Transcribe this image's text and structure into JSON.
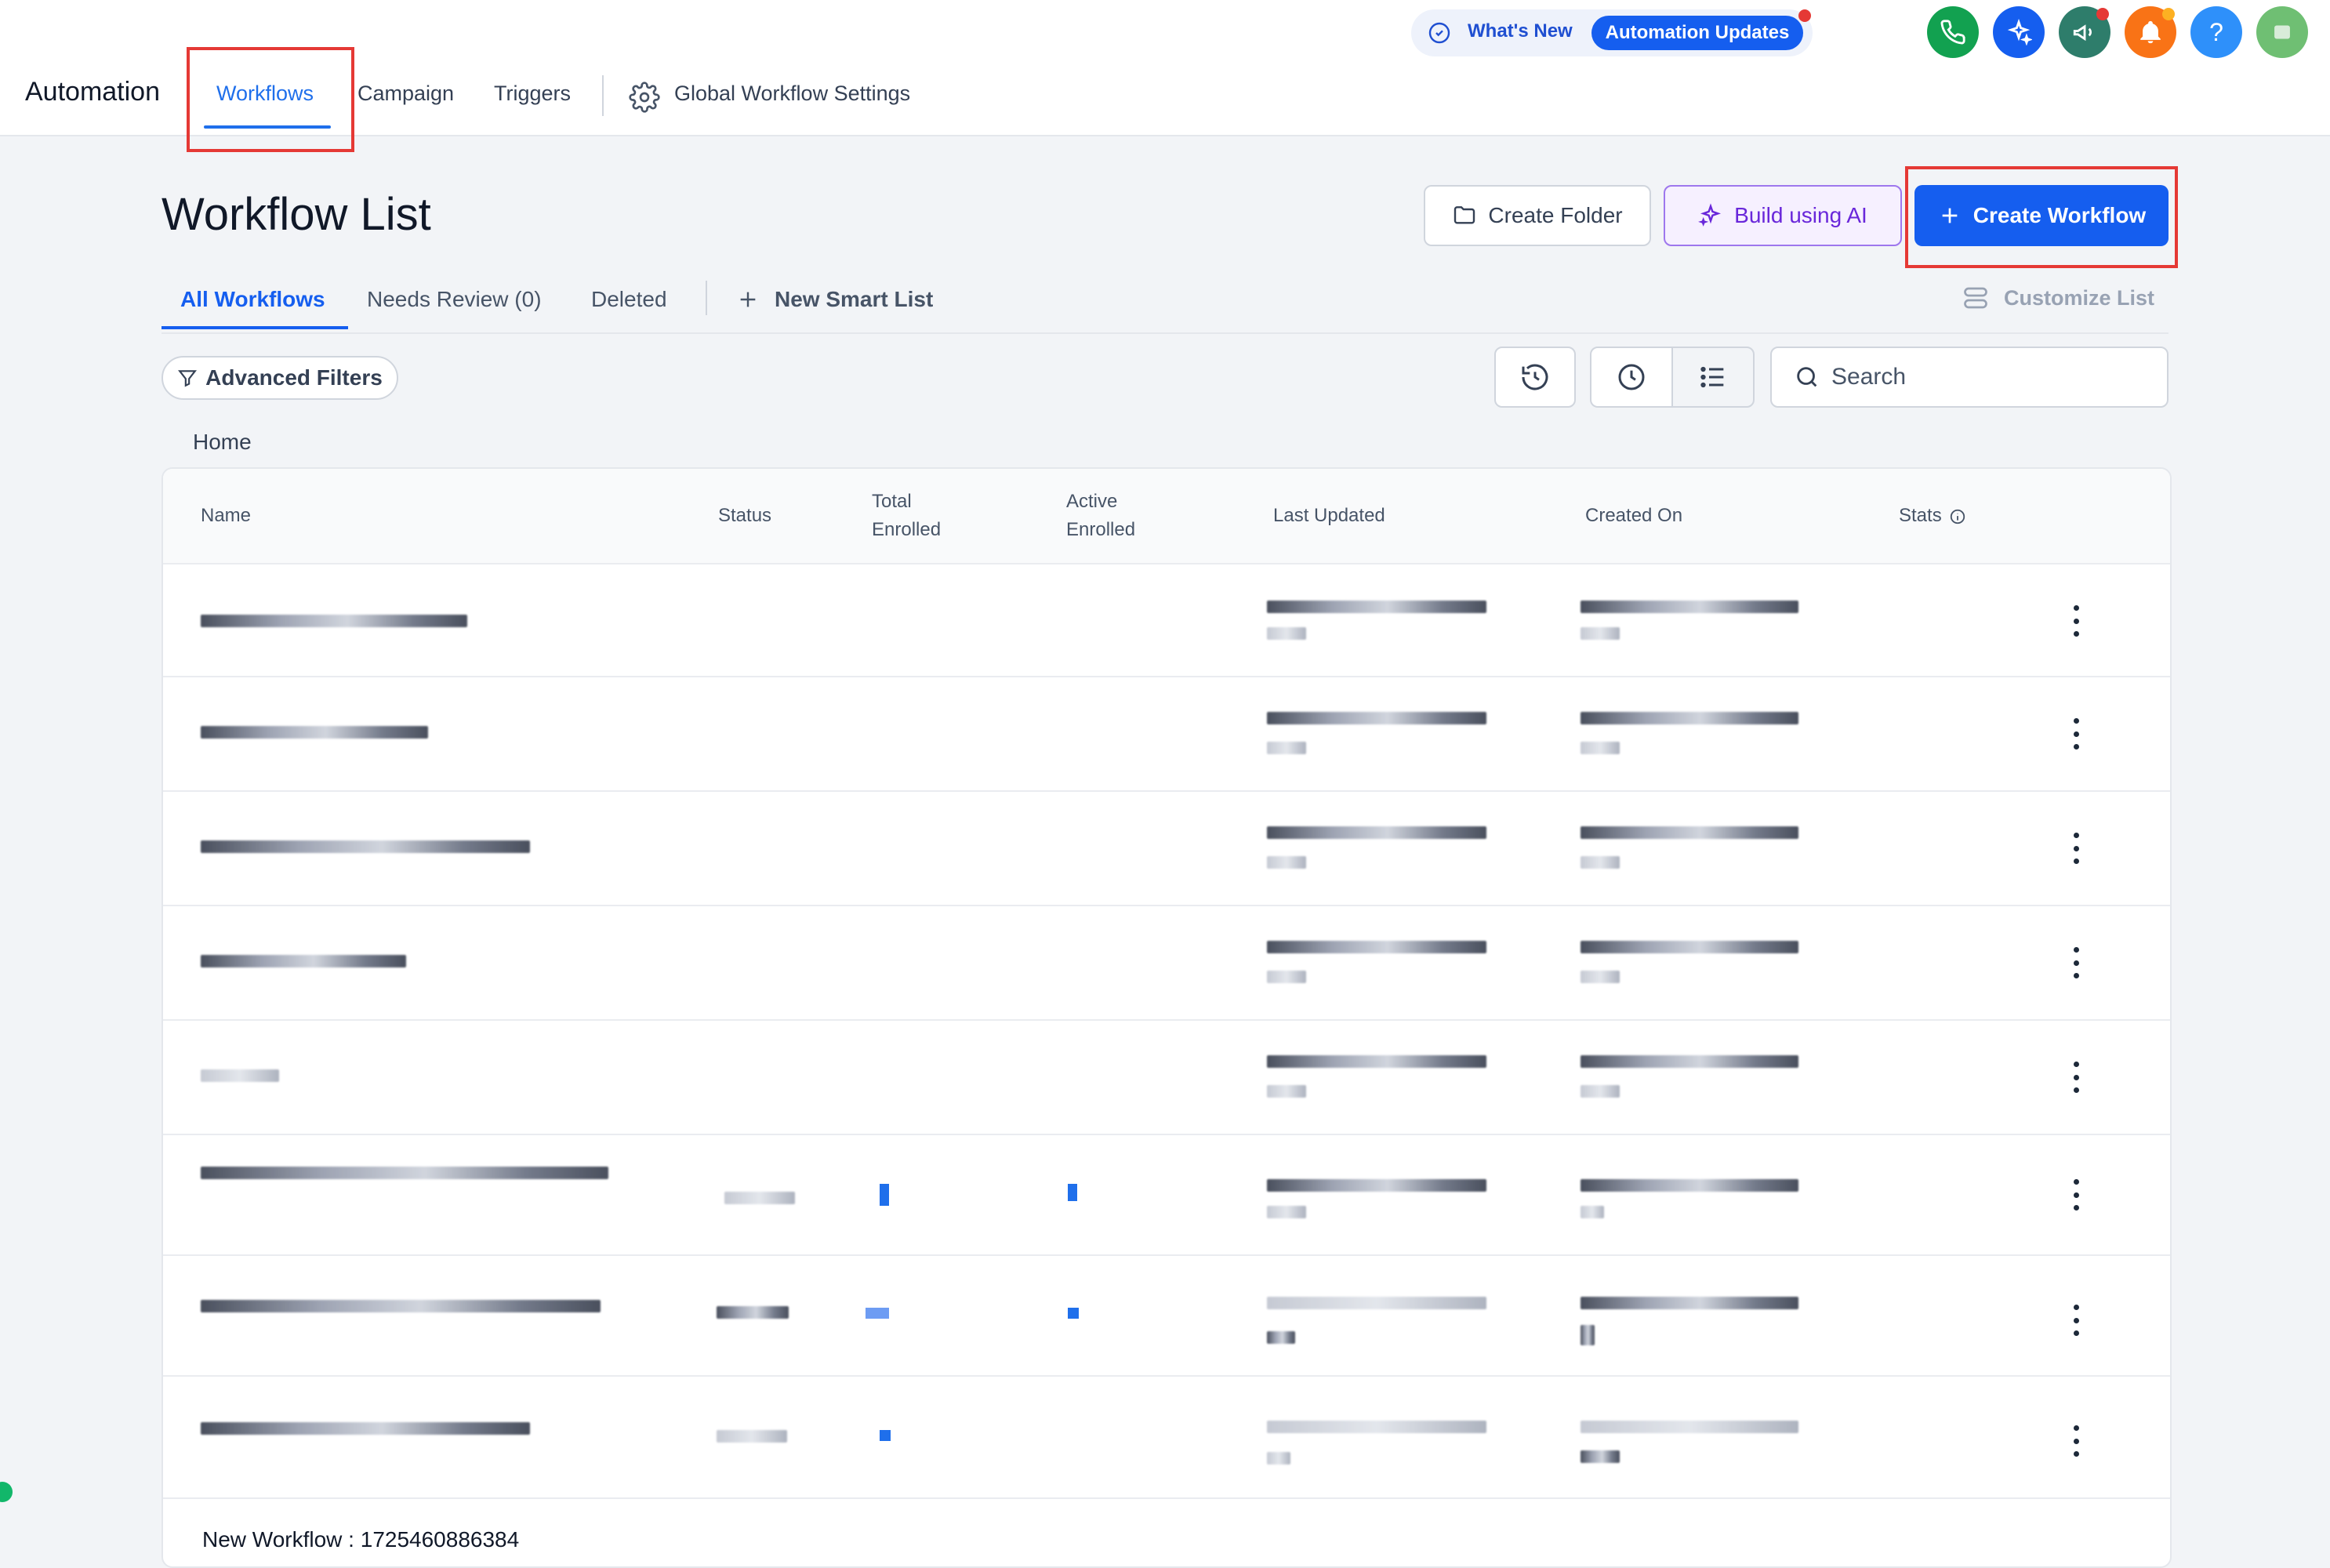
{
  "header": {
    "brand": "Automation",
    "tabs": [
      {
        "label": "Workflows",
        "active": true
      },
      {
        "label": "Campaign"
      },
      {
        "label": "Triggers"
      }
    ],
    "settings_label": "Global Workflow Settings",
    "whats_new": {
      "label": "What's New",
      "pill": "Automation Updates"
    },
    "icons": [
      {
        "name": "phone-icon",
        "color": "#12a150"
      },
      {
        "name": "ai-sparkle-icon",
        "color": "#155eef"
      },
      {
        "name": "megaphone-icon",
        "color": "#2e7d6b"
      },
      {
        "name": "bell-icon",
        "color": "#f97316"
      },
      {
        "name": "help-icon",
        "color": "#2e90fa",
        "glyph": "?"
      },
      {
        "name": "avatar",
        "color": "#6fbf73"
      }
    ]
  },
  "page": {
    "title": "Workflow List",
    "buttons": {
      "create_folder": "Create Folder",
      "build_ai": "Build using AI",
      "create_workflow": "Create Workflow"
    },
    "subtabs": [
      {
        "label": "All Workflows",
        "active": true
      },
      {
        "label": "Needs Review (0)"
      },
      {
        "label": "Deleted"
      }
    ],
    "new_smart_list": "New Smart List",
    "customize_list": "Customize List",
    "advanced_filters": "Advanced Filters",
    "search_placeholder": "Search",
    "breadcrumb": "Home"
  },
  "table": {
    "columns": {
      "name": "Name",
      "status": "Status",
      "total_enrolled_1": "Total",
      "total_enrolled_2": "Enrolled",
      "active_enrolled_1": "Active",
      "active_enrolled_2": "Enrolled",
      "last_updated": "Last Updated",
      "created_on": "Created On",
      "stats": "Stats"
    },
    "last_row_name": "New Workflow : 1725460886384"
  }
}
